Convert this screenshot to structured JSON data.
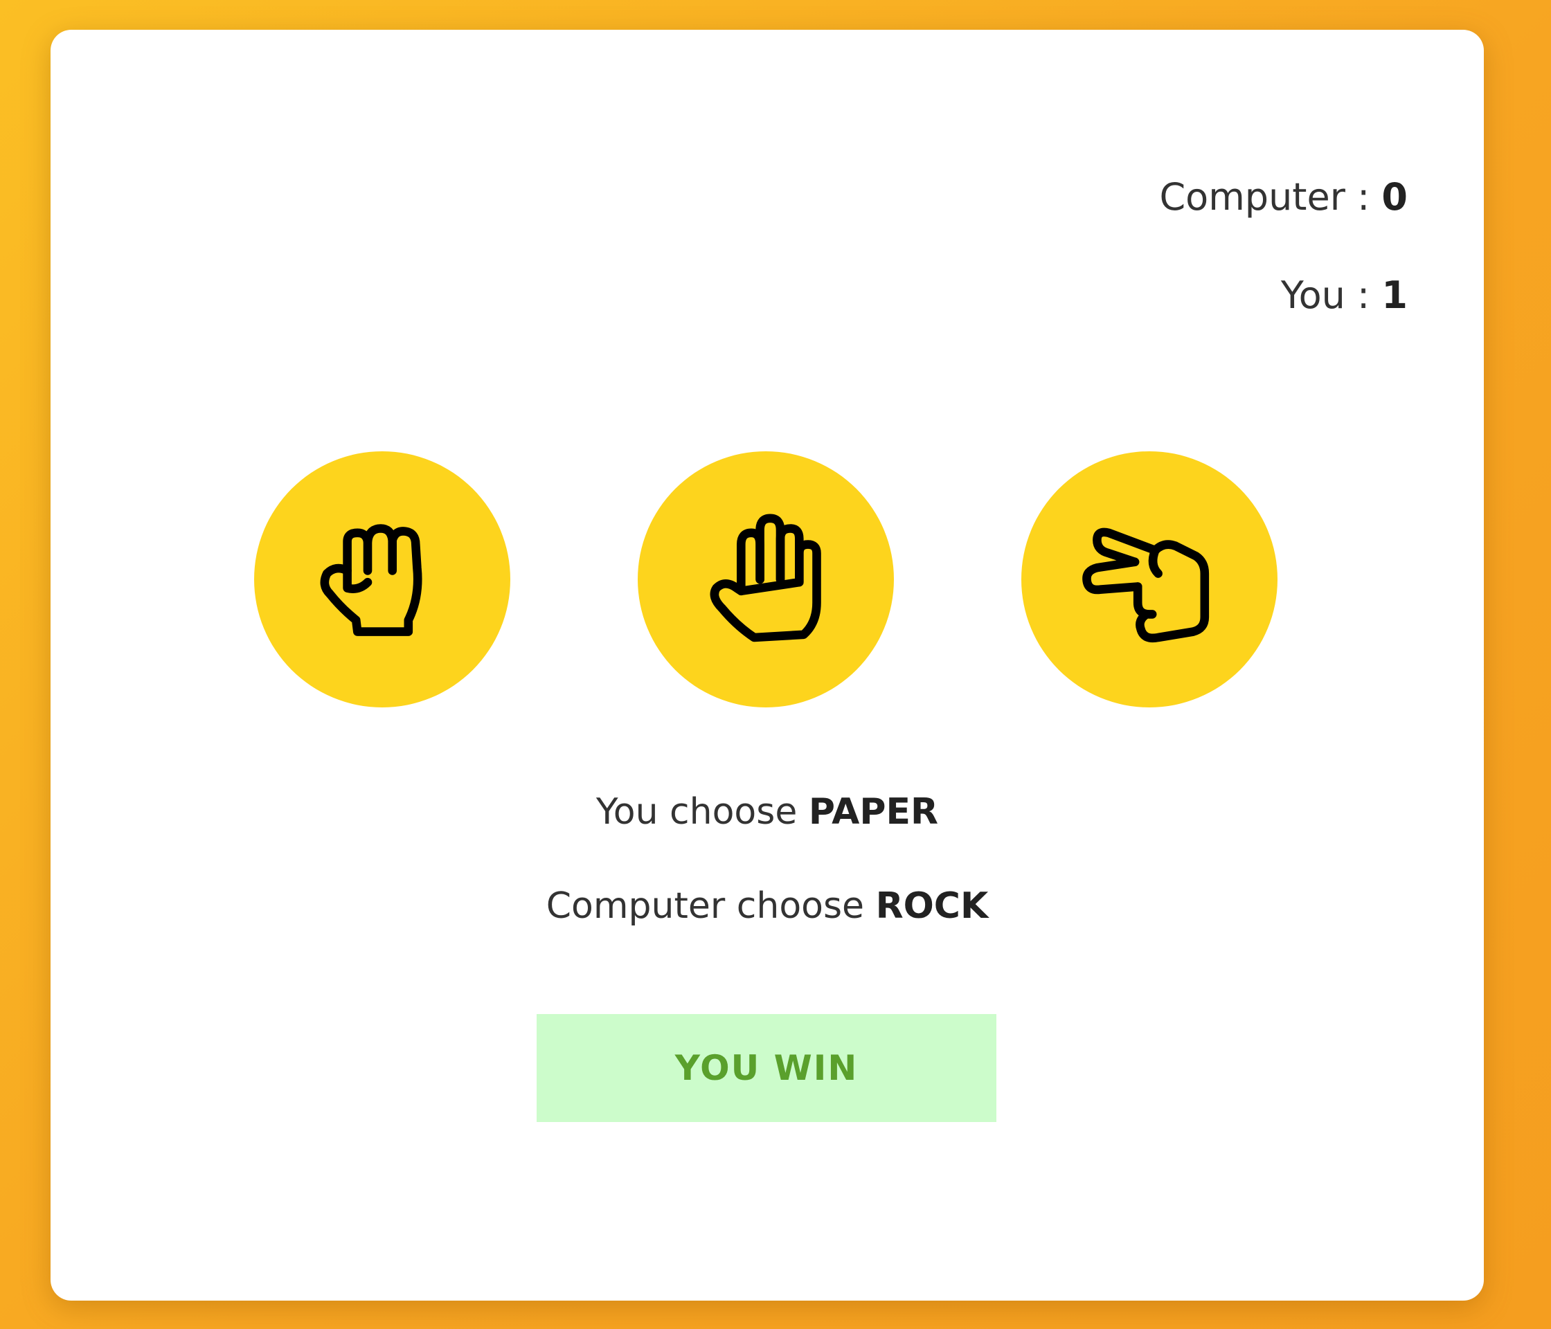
{
  "score": {
    "computer_label": "Computer : ",
    "computer_value": "0",
    "you_label": "You : ",
    "you_value": "1"
  },
  "choices": [
    {
      "name": "rock",
      "icon": "fist-icon"
    },
    {
      "name": "paper",
      "icon": "open-hand-icon"
    },
    {
      "name": "scissors",
      "icon": "two-fingers-hand-icon"
    }
  ],
  "status": {
    "you_prefix": "You choose ",
    "you_choice": "PAPER",
    "computer_prefix": "Computer choose ",
    "computer_choice": "ROCK"
  },
  "result": {
    "label": "YOU WIN"
  },
  "colors": {
    "background": "#f7a522",
    "card": "#ffffff",
    "choice_circle": "#fdd41d",
    "result_bg": "#ccfccb",
    "result_text": "#5aa02c"
  }
}
